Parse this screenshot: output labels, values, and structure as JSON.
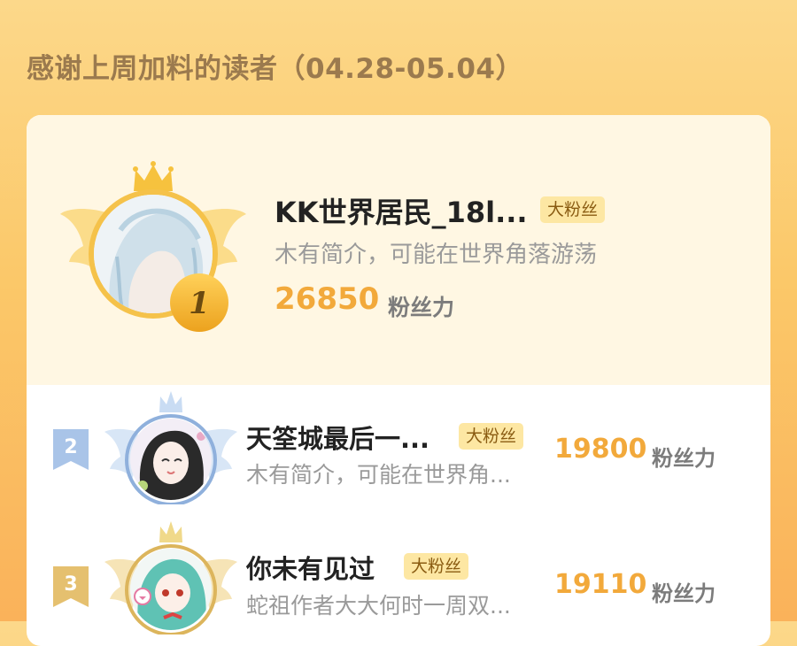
{
  "page": {
    "title": "感谢上周加料的读者（04.28-05.04）"
  },
  "leaderboard": [
    {
      "rank": "1",
      "name": "KK世界居民_18l...",
      "tag": "大粉丝",
      "bio": "木有简介，可能在世界角落游荡",
      "score": "26850",
      "unit": "粉丝力"
    },
    {
      "rank": "2",
      "name": "天筌城最后一...",
      "tag": "大粉丝",
      "bio": "木有简介，可能在世界角...",
      "score": "19800",
      "unit": "粉丝力"
    },
    {
      "rank": "3",
      "name": "你未有见过",
      "tag": "大粉丝",
      "bio": "蛇祖作者大大何时一周双...",
      "score": "19110",
      "unit": "粉丝力"
    }
  ],
  "colors": {
    "gold": "#f2b63c",
    "silver": "#a9c4e8",
    "bronze": "#e8c779",
    "score": "#f2a93b"
  },
  "icons": [
    "crown-icon",
    "wings-icon",
    "rank-medal-icon",
    "rank-flag-icon"
  ]
}
